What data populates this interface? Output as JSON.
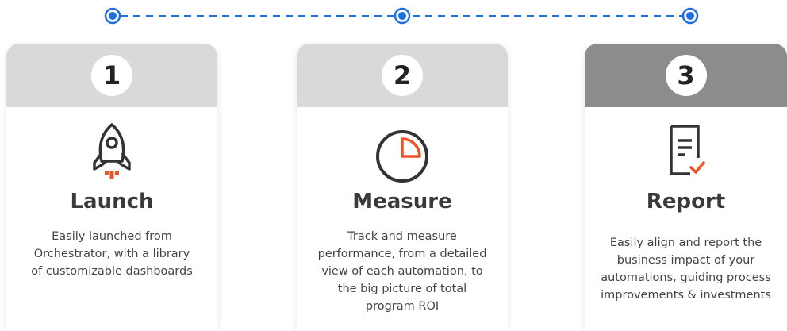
{
  "colors": {
    "accent_blue": "#1e6fe0",
    "accent_orange": "#f05323",
    "header_gray": "#d9d9d9",
    "header_dark": "#8c8c8c"
  },
  "steps": [
    {
      "number": "1",
      "icon": "rocket-icon",
      "title": "Launch",
      "description_lines": [
        "Easily launched from",
        "Orchestrator, with a library",
        "of customizable dashboards"
      ]
    },
    {
      "number": "2",
      "icon": "pie-timer-icon",
      "title": "Measure",
      "description_lines": [
        "Track and measure",
        "performance, from a detailed",
        "view of each automation, to",
        "the big picture of total",
        "program ROI"
      ]
    },
    {
      "number": "3",
      "icon": "document-check-icon",
      "title": "Report",
      "description_lines": [
        "Easily align and report the",
        "business impact of your",
        "automations, guiding process",
        "improvements & investments"
      ]
    }
  ]
}
